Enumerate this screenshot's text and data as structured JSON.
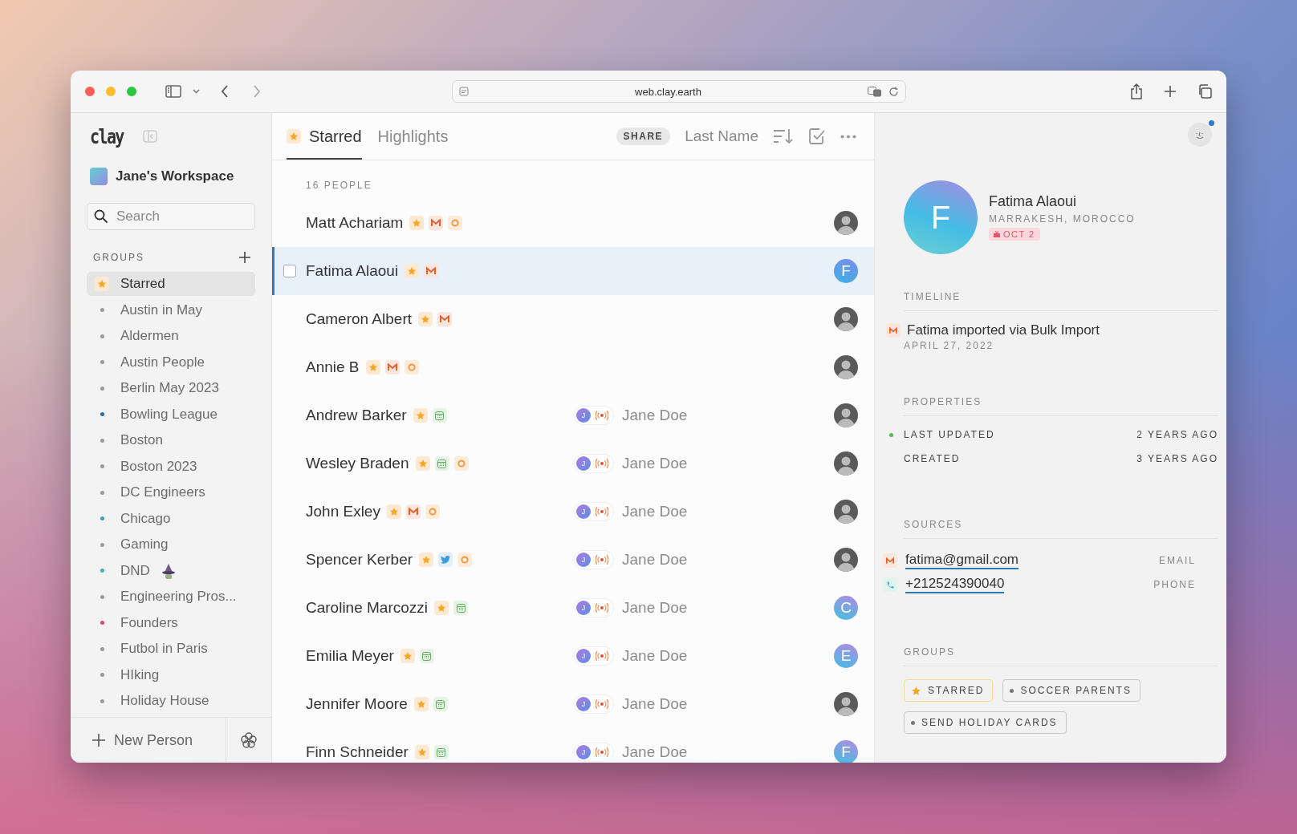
{
  "browser": {
    "url": "web.clay.earth"
  },
  "sidebar": {
    "logo": "clay",
    "workspace": "Jane's Workspace",
    "search": {
      "placeholder": "Search"
    },
    "groups_title": "GROUPS",
    "groups": [
      {
        "label": "Starred",
        "kind": "starred",
        "selected": true
      },
      {
        "label": "Austin in May",
        "kind": "dot",
        "color": "#9b9b9b",
        "selected": false
      },
      {
        "label": "Aldermen",
        "kind": "dot",
        "color": "#9b9b9b",
        "selected": false
      },
      {
        "label": "Austin People",
        "kind": "dot",
        "color": "#9b9b9b",
        "selected": false
      },
      {
        "label": "Berlin May 2023",
        "kind": "dot",
        "color": "#9b9b9b",
        "selected": false
      },
      {
        "label": "Bowling League",
        "kind": "dot",
        "color": "#1f6fb2",
        "selected": false
      },
      {
        "label": "Boston",
        "kind": "dot",
        "color": "#9b9b9b",
        "selected": false
      },
      {
        "label": "Boston 2023",
        "kind": "dot",
        "color": "#9b9b9b",
        "selected": false
      },
      {
        "label": "DC Engineers",
        "kind": "dot",
        "color": "#9b9b9b",
        "selected": false
      },
      {
        "label": "Chicago",
        "kind": "dot",
        "color": "#3a9fc9",
        "selected": false
      },
      {
        "label": "Gaming",
        "kind": "dot",
        "color": "#9b9b9b",
        "selected": false
      },
      {
        "label": "DND",
        "kind": "dot",
        "color": "#3fb3b0",
        "selected": false,
        "hat": true
      },
      {
        "label": "Engineering Pros...",
        "kind": "dot",
        "color": "#9b9b9b",
        "selected": false
      },
      {
        "label": "Founders",
        "kind": "dot",
        "color": "#e0457b",
        "selected": false
      },
      {
        "label": "Futbol in Paris",
        "kind": "dot",
        "color": "#9b9b9b",
        "selected": false
      },
      {
        "label": "HIking",
        "kind": "dot",
        "color": "#9b9b9b",
        "selected": false
      },
      {
        "label": "Holiday House",
        "kind": "dot",
        "color": "#9b9b9b",
        "selected": false
      }
    ],
    "new_person": "New Person"
  },
  "list": {
    "tabs": [
      {
        "label": "Starred",
        "selected": true
      },
      {
        "label": "Highlights",
        "selected": false
      }
    ],
    "share": "SHARE",
    "sort": "Last Name",
    "count": "16 PEOPLE",
    "rows": [
      {
        "name": "Matt Achariam",
        "badges": [
          {
            "kind": "star"
          },
          {
            "kind": "mail"
          },
          {
            "kind": "ring"
          }
        ],
        "avatar": {
          "kind": "photo"
        },
        "selected": false
      },
      {
        "name": "Fatima Alaoui",
        "badges": [
          {
            "kind": "star"
          },
          {
            "kind": "mail"
          }
        ],
        "avatar": {
          "kind": "letter",
          "letter": "F"
        },
        "selected": true
      },
      {
        "name": "Cameron Albert",
        "badges": [
          {
            "kind": "star"
          },
          {
            "kind": "mail"
          }
        ],
        "avatar": {
          "kind": "photo"
        },
        "selected": false
      },
      {
        "name": "Annie B",
        "badges": [
          {
            "kind": "star"
          },
          {
            "kind": "mail"
          },
          {
            "kind": "ring"
          }
        ],
        "avatar": {
          "kind": "photo"
        },
        "selected": false
      },
      {
        "name": "Andrew Barker",
        "badges": [
          {
            "kind": "star"
          },
          {
            "kind": "calendar"
          }
        ],
        "owner": {
          "initial": "J",
          "name": "Jane Doe"
        },
        "avatar": {
          "kind": "photo"
        },
        "selected": false
      },
      {
        "name": "Wesley Braden",
        "badges": [
          {
            "kind": "star"
          },
          {
            "kind": "calendar"
          },
          {
            "kind": "ring"
          }
        ],
        "owner": {
          "initial": "J",
          "name": "Jane Doe"
        },
        "avatar": {
          "kind": "photo"
        },
        "selected": false
      },
      {
        "name": "John Exley",
        "badges": [
          {
            "kind": "star"
          },
          {
            "kind": "mail"
          },
          {
            "kind": "ring"
          }
        ],
        "owner": {
          "initial": "J",
          "name": "Jane Doe"
        },
        "avatar": {
          "kind": "photo"
        },
        "selected": false
      },
      {
        "name": "Spencer Kerber",
        "badges": [
          {
            "kind": "star"
          },
          {
            "kind": "bird"
          },
          {
            "kind": "ring"
          }
        ],
        "owner": {
          "initial": "J",
          "name": "Jane Doe"
        },
        "avatar": {
          "kind": "photo"
        },
        "selected": false
      },
      {
        "name": "Caroline Marcozzi",
        "badges": [
          {
            "kind": "star"
          },
          {
            "kind": "calendar"
          }
        ],
        "owner": {
          "initial": "J",
          "name": "Jane Doe"
        },
        "avatar": {
          "kind": "letter",
          "letter": "C"
        },
        "selected": false
      },
      {
        "name": "Emilia Meyer",
        "badges": [
          {
            "kind": "star"
          },
          {
            "kind": "calendar"
          }
        ],
        "owner": {
          "initial": "J",
          "name": "Jane Doe"
        },
        "avatar": {
          "kind": "letter",
          "letter": "E"
        },
        "selected": false
      },
      {
        "name": "Jennifer Moore",
        "badges": [
          {
            "kind": "star"
          },
          {
            "kind": "calendar"
          }
        ],
        "owner": {
          "initial": "J",
          "name": "Jane Doe"
        },
        "avatar": {
          "kind": "photo"
        },
        "selected": false
      },
      {
        "name": "Finn Schneider",
        "badges": [
          {
            "kind": "star"
          },
          {
            "kind": "calendar"
          }
        ],
        "owner": {
          "initial": "J",
          "name": "Jane Doe"
        },
        "avatar": {
          "kind": "letter",
          "letter": "F"
        },
        "selected": false
      }
    ]
  },
  "detail": {
    "letter": "F",
    "name": "Fatima Alaoui",
    "location": "MARRAKESH, MOROCCO",
    "birthday": "OCT 2",
    "timeline_title": "TIMELINE",
    "timeline": [
      {
        "text": "Fatima imported via Bulk Import",
        "date": "APRIL 27, 2022"
      }
    ],
    "properties_title": "PROPERTIES",
    "properties": [
      {
        "label": "LAST UPDATED",
        "value": "2 YEARS AGO",
        "marked": true
      },
      {
        "label": "CREATED",
        "value": "3 YEARS AGO",
        "marked": false
      }
    ],
    "sources_title": "SOURCES",
    "sources": [
      {
        "kind": "email",
        "value": "fatima@gmail.com",
        "label": "EMAIL"
      },
      {
        "kind": "phone",
        "value": "+212524390040",
        "label": "PHONE"
      }
    ],
    "groups_title": "GROUPS",
    "groups": [
      {
        "label": "STARRED",
        "kind": "starred"
      },
      {
        "label": "SOCCER PARENTS",
        "kind": "dot"
      },
      {
        "label": "SEND HOLIDAY CARDS",
        "kind": "dot"
      }
    ]
  }
}
